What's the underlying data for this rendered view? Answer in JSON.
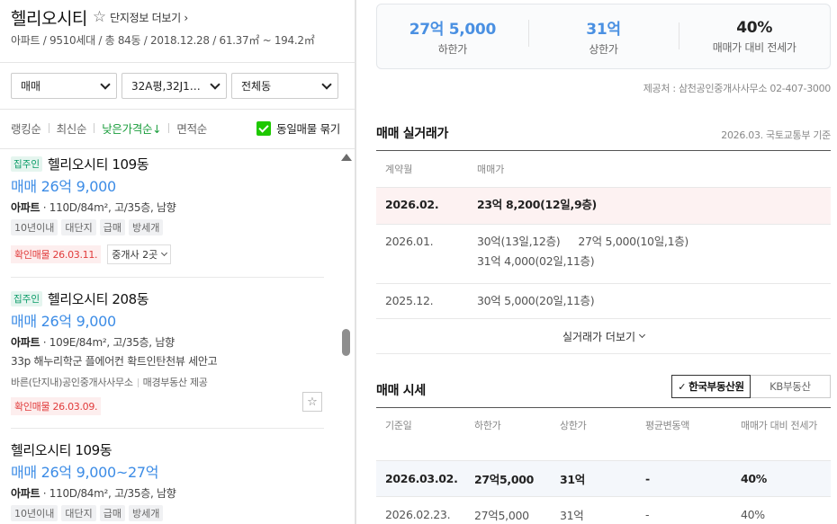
{
  "complex": {
    "name": "헬리오시티",
    "info_link": "단지정보 더보기",
    "subinfo": "아파트 / 9510세대 / 총 84동 / 2018.12.28 / 61.37㎡ ~ 194.2㎡"
  },
  "filters": [
    "매매",
    "32A평,32J1…",
    "전체동"
  ],
  "sort": {
    "items": [
      "랭킹순",
      "최신순",
      "낮은가격순↓",
      "면적순"
    ],
    "same_listing_label": "동일매물 묶기"
  },
  "listings": [
    {
      "owner_badge": "집주인",
      "name": "헬리오시티 109동",
      "price": "매매 26억 9,000",
      "type": "아파트",
      "spec": "110D/84m², 고/35층, 남향",
      "tags": [
        "10년이내",
        "대단지",
        "급매",
        "방세개"
      ],
      "confirm": "확인매물 26.03.11.",
      "agents": "중개사 2곳"
    },
    {
      "owner_badge": "집주인",
      "name": "헬리오시티 208동",
      "price": "매매 26억 9,000",
      "type": "아파트",
      "spec": "109E/84m², 고/35층, 남향",
      "desc": "33p 해누리학군 플에어컨 확트인탄천뷰 세안고",
      "agent_name": "바른(단지내)공인중개사사무소",
      "agent_provider": "매경부동산 제공",
      "confirm": "확인매물 26.03.09."
    },
    {
      "name": "헬리오시티 109동",
      "price": "매매 26억 9,000~27억",
      "type": "아파트",
      "spec": "110D/84m², 고/35층, 남향",
      "tags": [
        "10년이내",
        "대단지",
        "급매",
        "방세개"
      ]
    }
  ],
  "summary": {
    "low_value": "27억 5,000",
    "low_label": "하한가",
    "high_value": "31억",
    "high_label": "상한가",
    "ratio_value": "40%",
    "ratio_label": "매매가 대비 전세가",
    "provider": "제공처 : 삼천공인중개사사무소 02-407-3000"
  },
  "deals": {
    "title": "매매 실거래가",
    "meta": "2026.03. 국토교통부 기준",
    "col_month": "계약월",
    "col_price": "매매가",
    "rows": [
      {
        "month": "2026.02.",
        "line1a": "23억 8,200(12일,9층)",
        "line1b": "",
        "line2": ""
      },
      {
        "month": "2026.01.",
        "line1a": "30억(13일,12층)",
        "line1b": "27억 5,000(10일,1층)",
        "line2": "31억 4,000(02일,11층)"
      },
      {
        "month": "2025.12.",
        "line1a": "30억 5,000(20일,11층)",
        "line1b": "",
        "line2": ""
      }
    ],
    "more": "실거래가 더보기"
  },
  "market": {
    "title": "매매 시세",
    "tab_active": "한국부동산원",
    "tab_inactive": "KB부동산",
    "cols": [
      "기준일",
      "하한가",
      "상한가",
      "평균변동액",
      "매매가 대비 전세가"
    ],
    "rows": [
      [
        "2026.03.02.",
        "27억5,000",
        "31억",
        "-",
        "40%"
      ],
      [
        "2026.02.23.",
        "27억5,000",
        "31억",
        "-",
        "40%"
      ]
    ]
  }
}
